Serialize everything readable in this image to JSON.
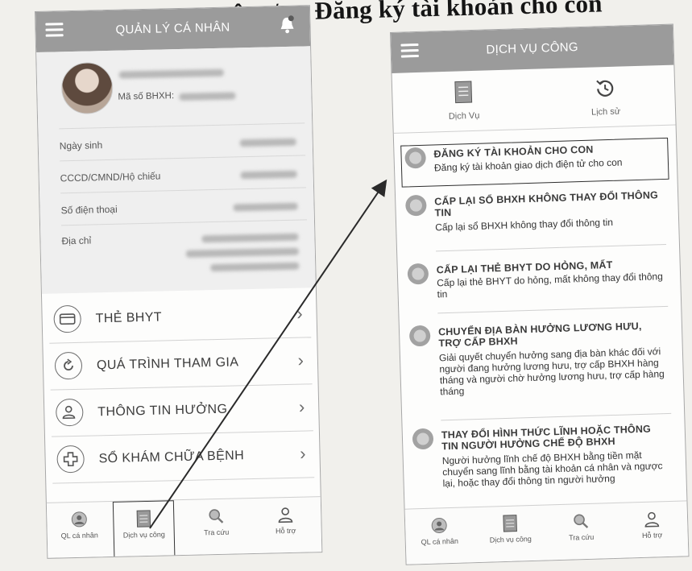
{
  "heading": {
    "prefix": "ị vụ công/",
    "text": "Đăng ký tài khoản cho con"
  },
  "left_screen": {
    "title": "QUẢN LÝ CÁ NHÂN",
    "bhxh_label": "Mã số BHXH:",
    "info_labels": [
      "Ngày sinh",
      "CCCD/CMND/Hộ chiếu",
      "Số điện thoại",
      "Địa chỉ"
    ],
    "menu": [
      {
        "label": "THẺ BHYT",
        "icon": "card-icon"
      },
      {
        "label": "QUÁ TRÌNH THAM GIA",
        "icon": "refresh-icon"
      },
      {
        "label": "THÔNG TIN HƯỞNG",
        "icon": "user-icon"
      },
      {
        "label": "SỔ KHÁM CHỮA BỆNH",
        "icon": "plus-icon"
      }
    ],
    "bottom_nav": [
      {
        "label": "QL cá nhân",
        "icon": "person-icon"
      },
      {
        "label": "Dịch vụ công",
        "icon": "document-icon"
      },
      {
        "label": "Tra cứu",
        "icon": "search-icon"
      },
      {
        "label": "Hỗ trợ",
        "icon": "support-icon"
      }
    ]
  },
  "right_screen": {
    "title": "DỊCH VỤ CÔNG",
    "tabs": [
      {
        "label": "Dịch Vụ",
        "icon": "document-icon"
      },
      {
        "label": "Lịch sử",
        "icon": "history-icon"
      }
    ],
    "services": [
      {
        "title": "ĐĂNG KÝ TÀI KHOẢN CHO CON",
        "desc": "Đăng ký tài khoản giao dịch điện tử cho con"
      },
      {
        "title": "CẤP LẠI SỔ BHXH KHÔNG THAY ĐỔI THÔNG TIN",
        "desc": "Cấp lại sổ BHXH không thay đổi thông tin"
      },
      {
        "title": "CẤP LẠI THẺ BHYT DO HỎNG, MẤT",
        "desc": "Cấp lại thẻ BHYT do hỏng, mất không thay đổi thông tin"
      },
      {
        "title": "CHUYỂN ĐỊA BÀN HƯỞNG LƯƠNG HƯU, TRỢ CẤP BHXH",
        "desc": "Giải quyết chuyển hưởng sang địa bàn khác đối với người đang hưởng lương hưu, trợ cấp BHXH hàng tháng và người chờ hưởng lương hưu, trợ cấp hàng tháng"
      },
      {
        "title": "THAY ĐỔI HÌNH THỨC LĨNH HOẶC THÔNG TIN NGƯỜI HƯỞNG CHẾ ĐỘ BHXH",
        "desc": "Người hưởng lĩnh chế độ BHXH bằng tiền mặt chuyển sang lĩnh bằng tài khoản cá nhân và ngược lại, hoặc thay đổi thông tin người hưởng"
      }
    ],
    "bottom_nav": [
      {
        "label": "QL cá nhân",
        "icon": "person-icon"
      },
      {
        "label": "Dịch vụ công",
        "icon": "document-icon"
      },
      {
        "label": "Tra cứu",
        "icon": "search-icon"
      },
      {
        "label": "Hỗ trợ",
        "icon": "support-icon"
      }
    ]
  }
}
